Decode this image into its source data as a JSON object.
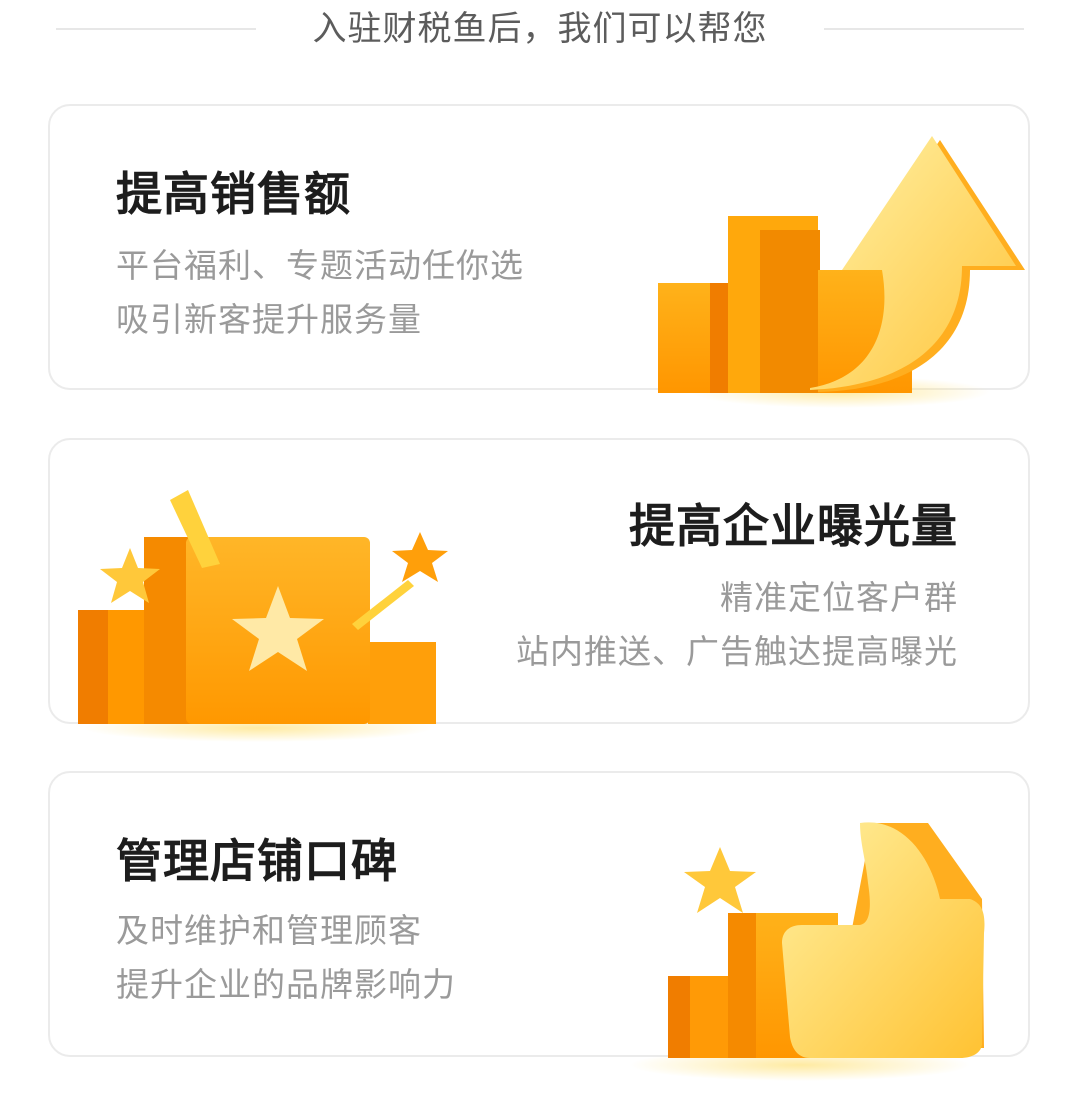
{
  "header": {
    "title": "入驻财税鱼后，我们可以帮您"
  },
  "cards": [
    {
      "title": "提高销售额",
      "lines": [
        "平台福利、专题活动任你选",
        "吸引新客提升服务量"
      ],
      "illustration_icon": "up-arrow-bar-chart-icon"
    },
    {
      "title": "提高企业曝光量",
      "lines": [
        "精准定位客户群",
        "站内推送、广告触达提高曝光"
      ],
      "illustration_icon": "star-podium-icon"
    },
    {
      "title": "管理店铺口碑",
      "lines": [
        "及时维护和管理顾客",
        "提升企业的品牌影响力"
      ],
      "illustration_icon": "thumbs-up-star-icon"
    }
  ],
  "colors": {
    "accent_orange": "#ff9a00",
    "accent_yellow": "#ffd24a",
    "title_text": "#1d1d1d",
    "body_text": "#9a9a9a",
    "header_text": "#5c5c5c"
  }
}
